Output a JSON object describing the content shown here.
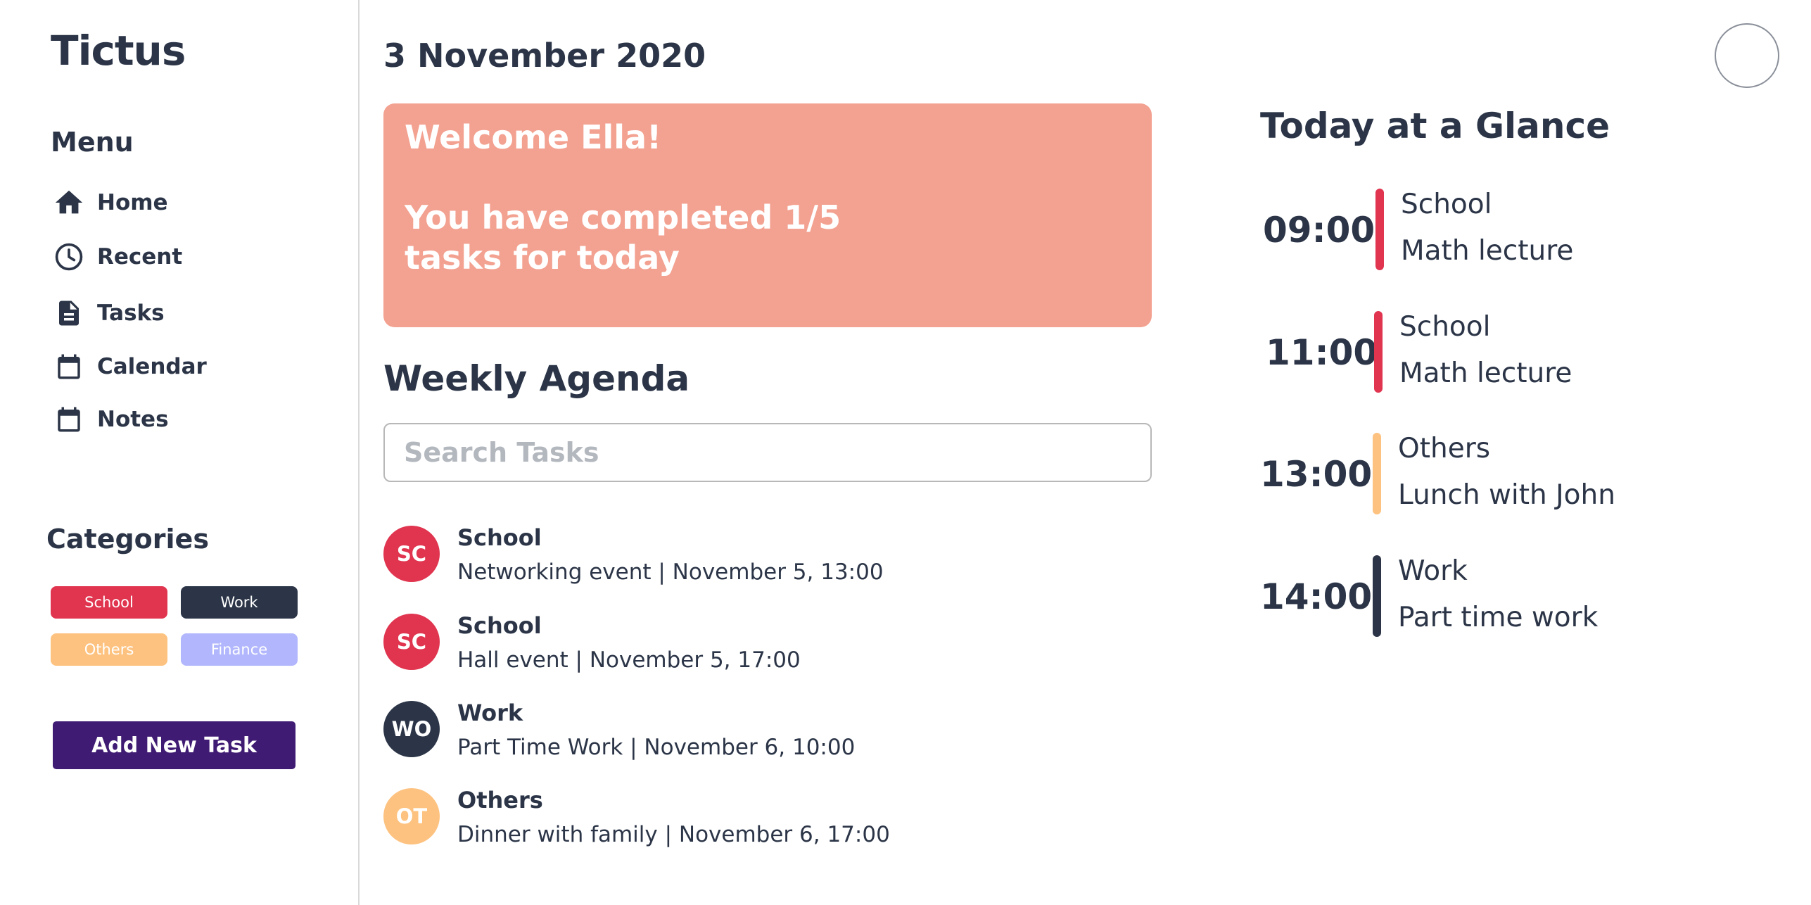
{
  "app": {
    "title": "Tictus"
  },
  "sidebar": {
    "menu_title": "Menu",
    "items": [
      {
        "label": "Home",
        "icon": "home-icon"
      },
      {
        "label": "Recent",
        "icon": "clock-icon"
      },
      {
        "label": "Tasks",
        "icon": "document-icon"
      },
      {
        "label": "Calendar",
        "icon": "calendar-icon"
      },
      {
        "label": "Notes",
        "icon": "calendar-icon"
      }
    ],
    "categories_title": "Categories",
    "categories": [
      {
        "label": "School",
        "color": "#e0344f"
      },
      {
        "label": "Work",
        "color": "#2b3547"
      },
      {
        "label": "Others",
        "color": "#fdc27f"
      },
      {
        "label": "Finance",
        "color": "#b1b6fd"
      }
    ],
    "add_button": "Add New Task"
  },
  "main": {
    "date": "3 November 2020",
    "welcome": {
      "line1": "Welcome Ella!",
      "line2": "You have completed 1/5",
      "line3": "tasks for today"
    },
    "agenda_title": "Weekly Agenda",
    "search_placeholder": "Search Tasks",
    "tasks": [
      {
        "initials": "SC",
        "category": "School",
        "desc": "Networking event | November 5, 13:00",
        "color": "#e0344f"
      },
      {
        "initials": "SC",
        "category": "School",
        "desc": "Hall event | November 5, 17:00",
        "color": "#e0344f"
      },
      {
        "initials": "WO",
        "category": "Work",
        "desc": "Part Time Work | November 6, 10:00",
        "color": "#2b3547"
      },
      {
        "initials": "OT",
        "category": "Others",
        "desc": "Dinner with family | November 6, 17:00",
        "color": "#fdc27f"
      }
    ]
  },
  "glance": {
    "title": "Today at a Glance",
    "items": [
      {
        "time": "09:00",
        "category": "School",
        "desc": "Math lecture",
        "color": "#e0344f"
      },
      {
        "time": "11:00",
        "category": "School",
        "desc": "Math lecture",
        "color": "#e0344f"
      },
      {
        "time": "13:00",
        "category": "Others",
        "desc": "Lunch with John",
        "color": "#fdc27f"
      },
      {
        "time": "14:00",
        "category": "Work",
        "desc": "Part time work",
        "color": "#2b3547"
      }
    ]
  },
  "colors": {
    "text": "#2b3547",
    "welcome_bg": "#f3a190",
    "add_button_bg": "#3f1b73"
  }
}
